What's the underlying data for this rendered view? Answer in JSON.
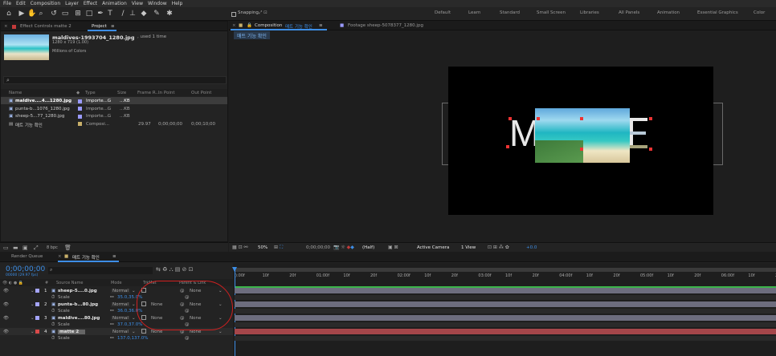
{
  "menu": [
    "File",
    "Edit",
    "Composition",
    "Layer",
    "Effect",
    "Animation",
    "View",
    "Window",
    "Help"
  ],
  "toolbar": {
    "snapping_label": "Snapping",
    "workspaces": [
      "Default",
      "Learn",
      "Standard",
      "Small Screen",
      "Libraries",
      "All Panels",
      "Animation",
      "Essential Graphics",
      "Color"
    ]
  },
  "project_panel": {
    "tab_effect_controls": "Effect Controls matte 2",
    "tab_project": "Project",
    "selected_name": "maldives-1993704_1280.jpg",
    "selected_usage": ", used 1 time",
    "selected_dims": "1280 x 719 (1.00)",
    "selected_colors": "Millions of Colors",
    "search_icon": "search-icon",
    "columns": [
      "Name",
      "Type",
      "Size",
      "Frame R...",
      "In Point",
      "Out Point"
    ],
    "items": [
      {
        "name": "maldive....4...1280.jpg",
        "type": "Importe...G",
        "size": "...KB",
        "fr": "",
        "in": "",
        "out": "",
        "color": "#9a9aff",
        "selected": true
      },
      {
        "name": "punta-b...1076_1280.jpg",
        "type": "Importe...G",
        "size": "...KB",
        "fr": "",
        "in": "",
        "out": "",
        "color": "#9a9aff",
        "selected": false
      },
      {
        "name": "sheep-5...77_1280.jpg",
        "type": "Importe...G",
        "size": "...KB",
        "fr": "",
        "in": "",
        "out": "",
        "color": "#9a9aff",
        "selected": false
      },
      {
        "name": "매트 기능 확인",
        "type": "Composi...",
        "size": "",
        "fr": "29.97",
        "in": "0;00;00;00",
        "out": "0;00;10;00",
        "color": "#c9b06a",
        "selected": false
      }
    ],
    "bottom_label": "8 bpc"
  },
  "comp_panel": {
    "tab_composition_prefix": "Composition",
    "tab_composition_name": "매트 기능 확인",
    "tab_footage": "Footage sheep-5078377_1280.jpg",
    "breadcrumb": "매트 기능 확인",
    "letters": [
      "M",
      "E"
    ]
  },
  "viewer_bar": {
    "zoom": "50%",
    "timecode": "0;00;00;00",
    "resolution": "(Half)",
    "camera": "Active Camera",
    "view": "1 View",
    "exposure": "+0.0"
  },
  "timeline": {
    "tab_render": "Render Queue",
    "tab_comp": "매트 기능 확인",
    "timecode": "0;00;00;00",
    "timecode_sub": "00000 (29.97 fps)",
    "headers": {
      "num": "#",
      "source": "Source Name",
      "mode": "Mode",
      "trkmat": "TrkMat",
      "parent": "Parent & Link"
    },
    "ruler": [
      "):00f",
      "10f",
      "20f",
      "01:00f",
      "10f",
      "20f",
      "02:00f",
      "10f",
      "20f",
      "03:00f",
      "10f",
      "20f",
      "04:00f",
      "10f",
      "20f",
      "05:00f",
      "10f",
      "20f",
      "06:00f",
      "10f",
      "20f"
    ],
    "layers": [
      {
        "num": "1",
        "name": "sheep-5....0.jpg",
        "mode": "Normal",
        "trkmat": "",
        "parent": "None",
        "scale": "35.0,35.0%",
        "color": "#a5a5ff",
        "bar": "#6d6d7e"
      },
      {
        "num": "2",
        "name": "punta-b...80.jpg",
        "mode": "Normal",
        "trkmat": "None",
        "parent": "None",
        "scale": "36.0,36.0%",
        "color": "#a5a5ff",
        "bar": "#6d6d7e"
      },
      {
        "num": "3",
        "name": "maldive....80.jpg",
        "mode": "Normal",
        "trkmat": "None",
        "parent": "None",
        "scale": "37.0,37.0%",
        "color": "#a5a5ff",
        "bar": "#6d6d7e"
      },
      {
        "num": "4",
        "name": "matte 2",
        "mode": "Normal",
        "trkmat": "None",
        "parent": "None",
        "scale": "137.0,137.0%",
        "color": "#d94a4a",
        "bar": "#a5464a"
      }
    ],
    "scale_label": "Scale"
  }
}
